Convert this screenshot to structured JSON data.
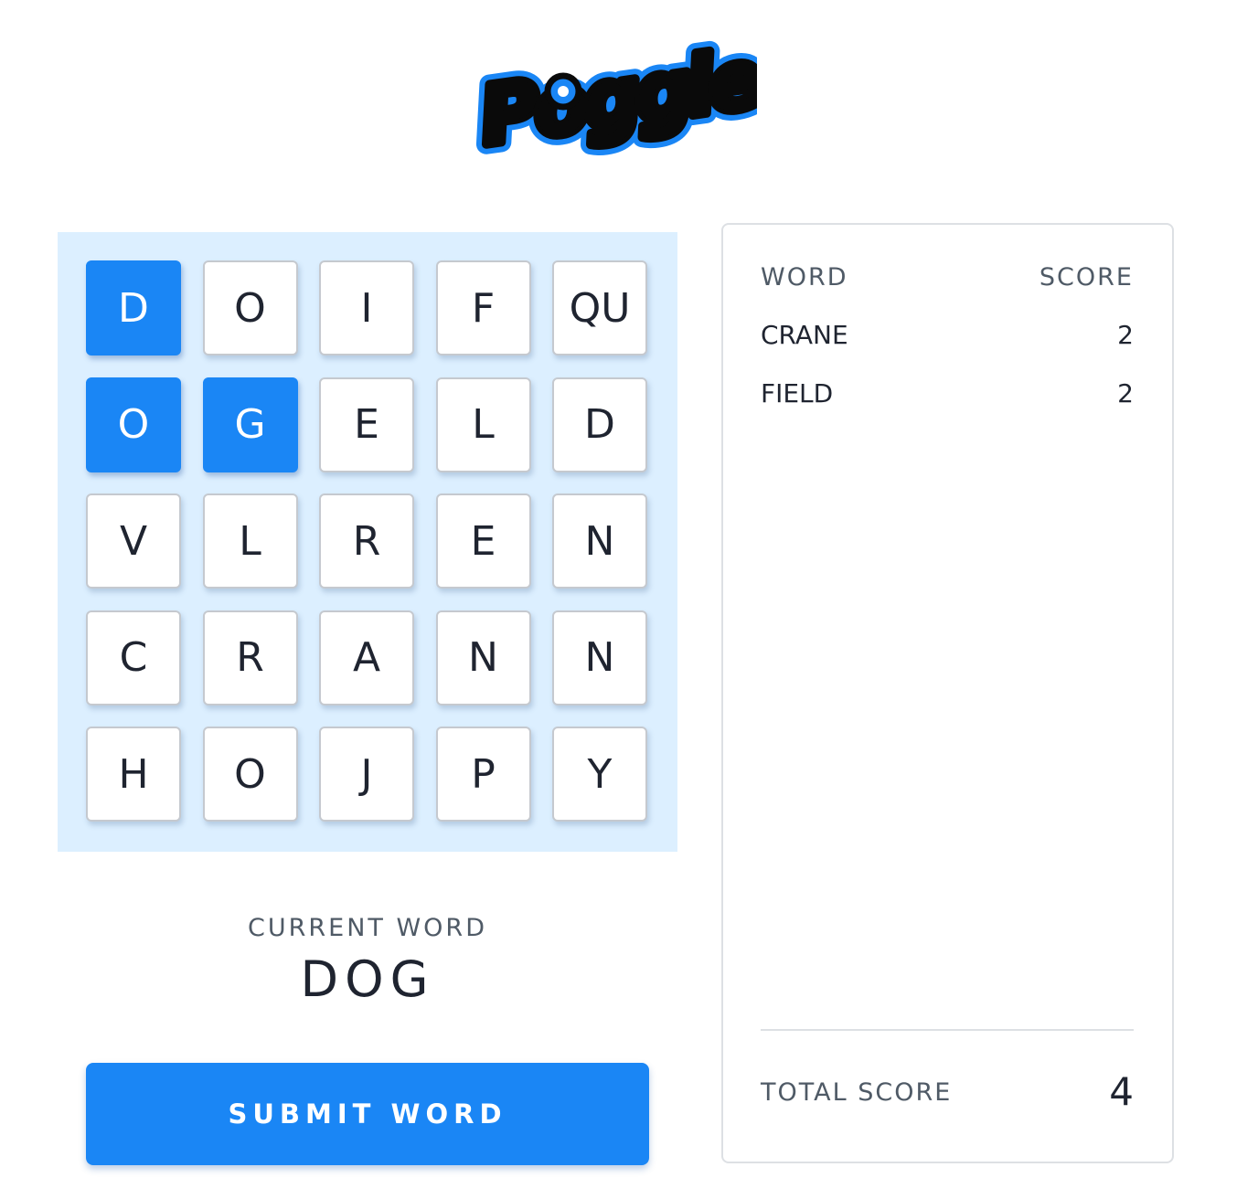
{
  "logo": {
    "text": "Poggle"
  },
  "board": {
    "tiles": [
      [
        {
          "letter": "D",
          "selected": true
        },
        {
          "letter": "O",
          "selected": false
        },
        {
          "letter": "I",
          "selected": false
        },
        {
          "letter": "F",
          "selected": false
        },
        {
          "letter": "QU",
          "selected": false
        }
      ],
      [
        {
          "letter": "O",
          "selected": true
        },
        {
          "letter": "G",
          "selected": true
        },
        {
          "letter": "E",
          "selected": false
        },
        {
          "letter": "L",
          "selected": false
        },
        {
          "letter": "D",
          "selected": false
        }
      ],
      [
        {
          "letter": "V",
          "selected": false
        },
        {
          "letter": "L",
          "selected": false
        },
        {
          "letter": "R",
          "selected": false
        },
        {
          "letter": "E",
          "selected": false
        },
        {
          "letter": "N",
          "selected": false
        }
      ],
      [
        {
          "letter": "C",
          "selected": false
        },
        {
          "letter": "R",
          "selected": false
        },
        {
          "letter": "A",
          "selected": false
        },
        {
          "letter": "N",
          "selected": false
        },
        {
          "letter": "N",
          "selected": false
        }
      ],
      [
        {
          "letter": "H",
          "selected": false
        },
        {
          "letter": "O",
          "selected": false
        },
        {
          "letter": "J",
          "selected": false
        },
        {
          "letter": "P",
          "selected": false
        },
        {
          "letter": "Y",
          "selected": false
        }
      ]
    ]
  },
  "current": {
    "label": "CURRENT WORD",
    "word": "DOG"
  },
  "submit": {
    "label": "SUBMIT WORD"
  },
  "scores": {
    "header_word": "WORD",
    "header_score": "SCORE",
    "rows": [
      {
        "word": "CRANE",
        "score": "2"
      },
      {
        "word": "FIELD",
        "score": "2"
      }
    ],
    "total_label": "TOTAL SCORE",
    "total_value": "4"
  },
  "colors": {
    "accent": "#1a86f5",
    "board_bg": "#dcefff",
    "text": "#1f2430",
    "muted": "#4f5a66"
  }
}
